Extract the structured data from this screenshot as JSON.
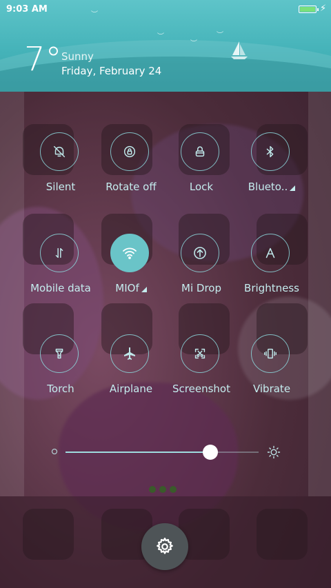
{
  "status_bar": {
    "time": "9:03 AM",
    "battery_color": "#7be07b",
    "charging_icon": "lightning-bolt-icon"
  },
  "weather": {
    "temperature": "7°",
    "condition": "Sunny",
    "date": "Friday, February 24"
  },
  "tiles": [
    {
      "label": "Silent",
      "icon": "bell-off-icon",
      "active": false
    },
    {
      "label": "Rotate off",
      "icon": "rotate-lock-icon",
      "active": false
    },
    {
      "label": "Lock",
      "icon": "lock-icon",
      "active": false
    },
    {
      "label": "Blueto..",
      "icon": "bluetooth-icon",
      "active": false,
      "expandable": true
    },
    {
      "label": "Mobile data",
      "icon": "mobile-data-icon",
      "active": false
    },
    {
      "label": "MIOf",
      "icon": "wifi-icon",
      "active": true,
      "expandable": true
    },
    {
      "label": "Mi Drop",
      "icon": "mi-drop-icon",
      "active": false
    },
    {
      "label": "Brightness",
      "icon": "brightness-auto-icon",
      "active": false
    },
    {
      "label": "Torch",
      "icon": "flashlight-icon",
      "active": false
    },
    {
      "label": "Airplane",
      "icon": "airplane-icon",
      "active": false
    },
    {
      "label": "Screenshot",
      "icon": "screenshot-icon",
      "active": false
    },
    {
      "label": "Vibrate",
      "icon": "vibrate-icon",
      "active": false
    }
  ],
  "brightness": {
    "level": 0.75,
    "low_icon": "brightness-low-icon",
    "high_icon": "brightness-high-icon"
  },
  "settings_button": {
    "icon": "gear-icon"
  },
  "colors": {
    "accent": "#6ac4c8",
    "header": "#45b3b9",
    "label": "#c4ecee"
  }
}
